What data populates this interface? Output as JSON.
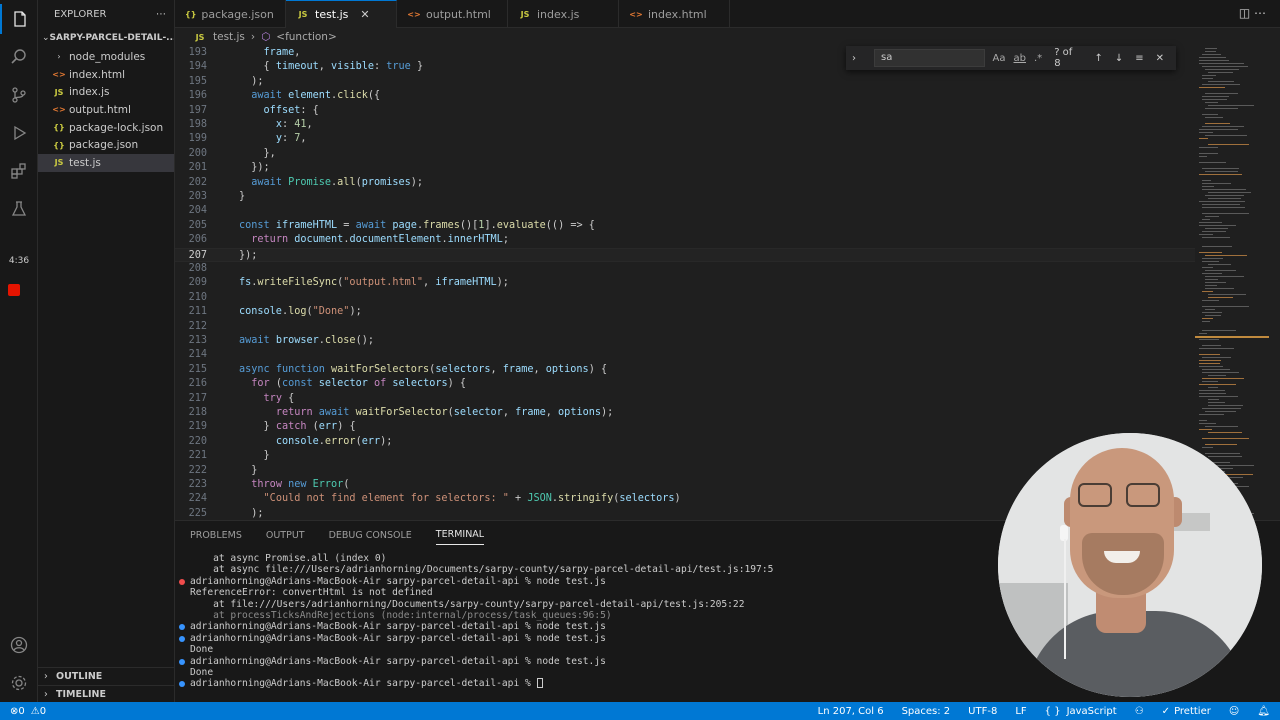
{
  "activity_bar": {
    "icons": [
      "files-icon",
      "search-icon",
      "source-control-icon",
      "run-debug-icon",
      "extensions-icon",
      "testing-icon",
      "account-icon",
      "settings-icon"
    ],
    "recording_time": "4:36"
  },
  "sidebar": {
    "title": "EXPLORER",
    "project": "SARPY-PARCEL-DETAIL-...",
    "files": [
      {
        "name": "node_modules",
        "type": "folder"
      },
      {
        "name": "index.html",
        "type": "html"
      },
      {
        "name": "index.js",
        "type": "js"
      },
      {
        "name": "output.html",
        "type": "html"
      },
      {
        "name": "package-lock.json",
        "type": "json"
      },
      {
        "name": "package.json",
        "type": "json"
      },
      {
        "name": "test.js",
        "type": "js",
        "selected": true
      }
    ],
    "outline_label": "OUTLINE",
    "timeline_label": "TIMELINE"
  },
  "tabs": [
    {
      "label": "package.json",
      "type": "json",
      "active": false
    },
    {
      "label": "test.js",
      "type": "js",
      "active": true
    },
    {
      "label": "output.html",
      "type": "html",
      "active": false
    },
    {
      "label": "index.js",
      "type": "js",
      "active": false
    },
    {
      "label": "index.html",
      "type": "html",
      "active": false
    }
  ],
  "breadcrumb": {
    "file": "test.js",
    "symbol": "<function>"
  },
  "find": {
    "query": "sa",
    "count": "? of 8",
    "opt_case": "Aa",
    "opt_word": "ab",
    "opt_regex": ".*"
  },
  "editor": {
    "current_line": 207,
    "lines": [
      {
        "n": 193,
        "text": "    frame,"
      },
      {
        "n": 194,
        "text": "    { timeout, visible: true }"
      },
      {
        "n": 195,
        "text": "  );"
      },
      {
        "n": 196,
        "text": "  await element.click({"
      },
      {
        "n": 197,
        "text": "    offset: {"
      },
      {
        "n": 198,
        "text": "      x: 41,"
      },
      {
        "n": 199,
        "text": "      y: 7,"
      },
      {
        "n": 200,
        "text": "    },"
      },
      {
        "n": 201,
        "text": "  });"
      },
      {
        "n": 202,
        "text": "  await Promise.all(promises);"
      },
      {
        "n": 203,
        "text": "}"
      },
      {
        "n": 204,
        "text": ""
      },
      {
        "n": 205,
        "text": "const iframeHTML = await page.frames()[1].evaluate(() => {"
      },
      {
        "n": 206,
        "text": "  return document.documentElement.innerHTML;"
      },
      {
        "n": 207,
        "text": "});"
      },
      {
        "n": 208,
        "text": ""
      },
      {
        "n": 209,
        "text": "fs.writeFileSync(\"output.html\", iframeHTML);"
      },
      {
        "n": 210,
        "text": ""
      },
      {
        "n": 211,
        "text": "console.log(\"Done\");"
      },
      {
        "n": 212,
        "text": ""
      },
      {
        "n": 213,
        "text": "await browser.close();"
      },
      {
        "n": 214,
        "text": ""
      },
      {
        "n": 215,
        "text": "async function waitForSelectors(selectors, frame, options) {"
      },
      {
        "n": 216,
        "text": "  for (const selector of selectors) {"
      },
      {
        "n": 217,
        "text": "    try {"
      },
      {
        "n": 218,
        "text": "      return await waitForSelector(selector, frame, options);"
      },
      {
        "n": 219,
        "text": "    } catch (err) {"
      },
      {
        "n": 220,
        "text": "      console.error(err);"
      },
      {
        "n": 221,
        "text": "    }"
      },
      {
        "n": 222,
        "text": "  }"
      },
      {
        "n": 223,
        "text": "  throw new Error("
      },
      {
        "n": 224,
        "text": "    \"Could not find element for selectors: \" + JSON.stringify(selectors)"
      },
      {
        "n": 225,
        "text": "  );"
      }
    ]
  },
  "panel": {
    "tabs": [
      "PROBLEMS",
      "OUTPUT",
      "DEBUG CONSOLE",
      "TERMINAL"
    ],
    "active_tab": "TERMINAL",
    "terminal_lines": [
      {
        "text": "    at async Promise.all (index 0)",
        "dot": "",
        "dim": false
      },
      {
        "text": "    at async file:///Users/adrianhorning/Documents/sarpy-county/sarpy-parcel-detail-api/test.js:197:5",
        "dot": "",
        "dim": false
      },
      {
        "text": "adrianhorning@Adrians-MacBook-Air sarpy-parcel-detail-api % node test.js",
        "dot": "red",
        "dim": false
      },
      {
        "text": "ReferenceError: convertHtml is not defined",
        "dot": "",
        "dim": false
      },
      {
        "text": "    at file:///Users/adrianhorning/Documents/sarpy-county/sarpy-parcel-detail-api/test.js:205:22",
        "dot": "",
        "dim": false
      },
      {
        "text": "    at processTicksAndRejections (node:internal/process/task_queues:96:5)",
        "dot": "",
        "dim": true
      },
      {
        "text": "adrianhorning@Adrians-MacBook-Air sarpy-parcel-detail-api % node test.js",
        "dot": "blue",
        "dim": false
      },
      {
        "text": "adrianhorning@Adrians-MacBook-Air sarpy-parcel-detail-api % node test.js",
        "dot": "blue",
        "dim": false
      },
      {
        "text": "Done",
        "dot": "",
        "dim": false
      },
      {
        "text": "adrianhorning@Adrians-MacBook-Air sarpy-parcel-detail-api % node test.js",
        "dot": "blue",
        "dim": false
      },
      {
        "text": "Done",
        "dot": "",
        "dim": false
      },
      {
        "text": "adrianhorning@Adrians-MacBook-Air sarpy-parcel-detail-api % ",
        "dot": "blue",
        "dim": false,
        "cursor": true
      }
    ]
  },
  "statusbar": {
    "errors": "0",
    "warnings": "0",
    "position": "Ln 207, Col 6",
    "spaces": "Spaces: 2",
    "encoding": "UTF-8",
    "eol": "LF",
    "language_braces": "{ }",
    "language": "JavaScript",
    "prettier": "Prettier"
  },
  "colors": {
    "keyword": "#569cd6",
    "control": "#c586c0",
    "function": "#dcdcaa",
    "string": "#ce9178",
    "number": "#b5cea8",
    "variable": "#9cdcfe",
    "class": "#4ec9b0",
    "punct": "#cccccc",
    "accent": "#0078d4"
  }
}
